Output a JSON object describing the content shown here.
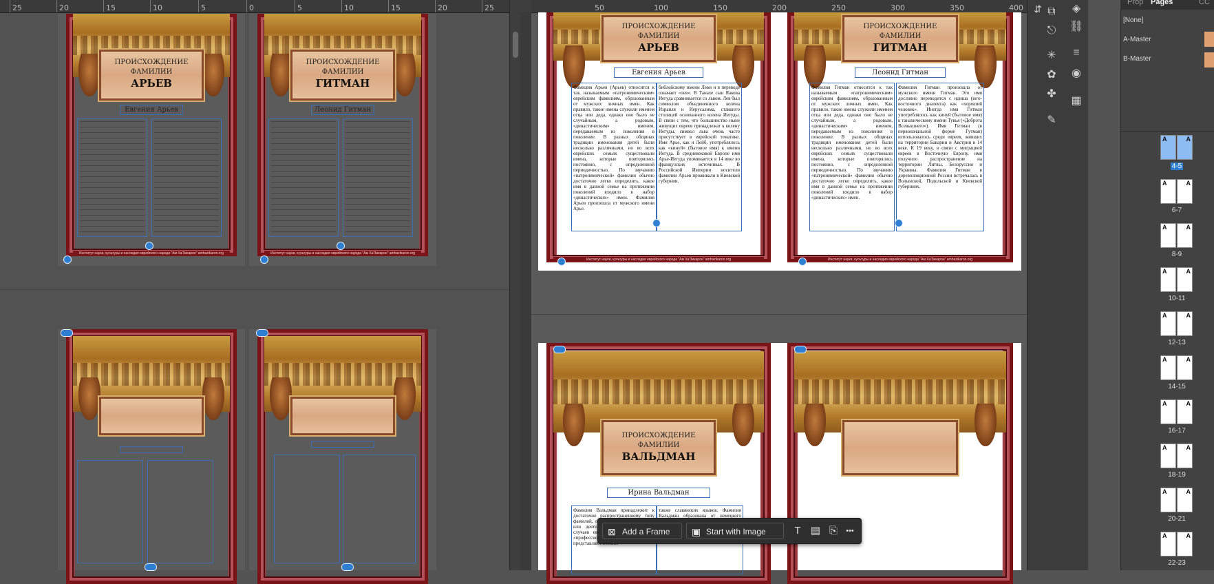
{
  "left_ruler": {
    "ticks": [
      "25",
      "20",
      "15",
      "10",
      "5",
      "0",
      "5",
      "10",
      "15",
      "20",
      "25"
    ]
  },
  "right_ruler": {
    "ticks": [
      "50",
      "100",
      "150",
      "200",
      "250",
      "300",
      "350",
      "400"
    ]
  },
  "spreads": {
    "top_left": {
      "page_a": {
        "line1": "ПРОИСХОЖДЕНИЕ",
        "line2": "ФАМИЛИИ",
        "name": "АРЬЕВ",
        "author": "Евгения Арьев"
      },
      "page_b": {
        "line1": "ПРОИСХОЖДЕНИЕ",
        "line2": "ФАМИЛИИ",
        "name": "ГИТМАН",
        "author": "Леонид Гитман"
      }
    },
    "top_right": {
      "page_a": {
        "line1": "ПРОИСХОЖДЕНИЕ",
        "line2": "ФАМИЛИИ",
        "name": "АРЬЕВ",
        "author": "Евгения Арьев",
        "col1": "Фамилия Арьев (Арьев) относится к так называемым «патронимическим» еврейским фамилиям, образованным от мужских личных имен. Как правило, такие имена служили именем отца или деда, однако оно было не случайным, а родовым, «династическим» именем, передаваемым из поколения в поколение. В разных общинах традиции именования детей были несколько различными, но во всех еврейских семьях существовали имена, которые повторялись постоянно, с определенной периодичностью. По звучанию «патронимической» фамилии обычно достаточно легко определить, какое имя в данной семье на протяжении поколений входило в набор «династических» имен. Фамилия Арьев произошла от мужского имени Арье.",
        "col2": "библейскому имени Леви и в переводе означает «лев». В Танахе сын Яакова Иегуда сравнивается со львом. Лев был символом объединенного колена Израиля и Иерусалима, ставшего столицей основанного колена Иегуды. В связи с тем, что большинство ныне живущих евреев принадлежат к колену Иегуды, символ льва очень часто присутствует в еврейской тематике. Имя Арье, как и Лейб, употреблялось как «кинуй» (бытовое имя) к имени Иегуда. В средневековой Европе имя Арье-Иегуда упоминается в 14 веке во французских источниках. В Российской Империи носители фамилии Арьев проживали в Киевской губернии."
      },
      "page_b": {
        "line1": "ПРОИСХОЖДЕНИЕ",
        "line2": "ФАМИЛИИ",
        "name": "ГИТМАН",
        "author": "Леонид Гитман",
        "col1": "Фамилия Гитман относится к так называемым «патронимическим» еврейским фамилиям, образованным от мужских личных имен. Как правило, такие имена служили именем отца или деда, однако оно было не случайным, а родовым, «династическим» именем, передаваемым из поколения в поколение. В разных общинах традиции именования детей были несколько различными, но во всех еврейских семьях существовали имена, которые повторялись постоянно, с определенной периодичностью. По звучанию «патронимической» фамилии обычно достаточно легко определить, какое имя в данной семье на протяжении поколений входило в набор «династических» имен.",
        "col2": "Фамилия Гитман произошла от мужского имени Гитман. Это имя дословно переводится с идиша (юго-восточного диалекта) как «хороший человек». Иногда имя Гитман употреблялось как кинуй (бытовое имя) к танахическому имени Тувья («Доброта Всевышнего»). Имя Гитман (в первоначальной форме Гутман) использовалось среди евреев, живших на территории Баварии и Австрии в 14 веке. К 19 веку, в связи с миграцией евреев в Восточную Европу, имя получило распространение на территории Литвы, Белоруссии и Украины. Фамилия Гитман в дореволюционной России встречалась в Волынской, Подольской и Киевской губерниях."
      }
    },
    "bottom_right": {
      "page_a": {
        "line1": "ПРОИСХОЖДЕНИЕ",
        "line2": "ФАМИЛИИ",
        "name": "ВАЛЬДМАН",
        "author": "Ирина Вальдман",
        "col1": "Фамилия Вальдман принадлежит к достаточно распространенному типу фамилий, образованных от профессии или деятельности. В большинстве случаев еврейские, так называемые «профессиональные» фамилии представляют собой...",
        "col2": "также славянских языков. Фамилия Вальдман образована от немецкого слова ... форманта «-ман» (человек), которое активно использовалось при образовании еврейских фамилий. По-видимому, первый..."
      }
    }
  },
  "footer_text": "Институт науки, культуры и наследия еврейского народа \"Ам Ха'Зикарон\" amhazikaron.org",
  "context_toolbar": {
    "add_frame": "Add a Frame",
    "start_with_image": "Start with Image",
    "more": "•••"
  },
  "panel_tabs": {
    "prop": "Prop",
    "pages": "Pages",
    "cc": "CC"
  },
  "masters": [
    {
      "label": "[None]"
    },
    {
      "label": "A-Master"
    },
    {
      "label": "B-Master"
    }
  ],
  "page_spreads": [
    {
      "label": "4-5",
      "left": "A",
      "right": "A",
      "selected": true
    },
    {
      "label": "6-7",
      "left": "A",
      "right": "A",
      "selected": false
    },
    {
      "label": "8-9",
      "left": "A",
      "right": "A",
      "selected": false
    },
    {
      "label": "10-11",
      "left": "A",
      "right": "A",
      "selected": false
    },
    {
      "label": "12-13",
      "left": "A",
      "right": "A",
      "selected": false
    },
    {
      "label": "14-15",
      "left": "A",
      "right": "A",
      "selected": false
    },
    {
      "label": "16-17",
      "left": "A",
      "right": "A",
      "selected": false
    },
    {
      "label": "18-19",
      "left": "A",
      "right": "A",
      "selected": false
    },
    {
      "label": "20-21",
      "left": "A",
      "right": "A",
      "selected": false
    },
    {
      "label": "22-23",
      "left": "A",
      "right": "A",
      "selected": false
    }
  ],
  "colors": {
    "accent": "#2e7fd1",
    "border_red": "#7a1418",
    "plaque": "#d9a882"
  }
}
